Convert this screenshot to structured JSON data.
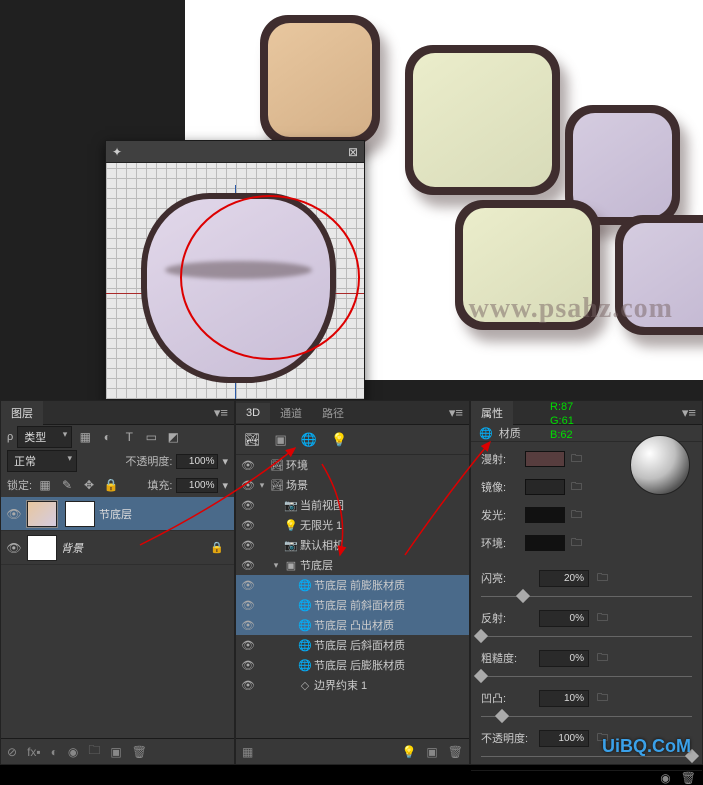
{
  "watermark": "www.psahz.com",
  "uibq": "UiBQ.CoM",
  "rgb": {
    "r": "R:87",
    "g": "G:61",
    "b": "B:62"
  },
  "layers_panel": {
    "tab": "图层",
    "kind_label": "类型",
    "blend_mode": "正常",
    "opacity_label": "不透明度:",
    "opacity_value": "100%",
    "lock_label": "锁定:",
    "fill_label": "填充:",
    "fill_value": "100%",
    "items": [
      {
        "name": "节底层",
        "active": true
      },
      {
        "name": "背景",
        "active": false
      }
    ]
  },
  "three_d_panel": {
    "tabs": [
      "3D",
      "通道",
      "路径"
    ],
    "tree": [
      {
        "depth": 0,
        "icon": "🏞",
        "name": "环境",
        "twisty": ""
      },
      {
        "depth": 0,
        "icon": "🏞",
        "name": "场景",
        "twisty": "▾"
      },
      {
        "depth": 1,
        "icon": "📷",
        "name": "当前视图",
        "twisty": ""
      },
      {
        "depth": 1,
        "icon": "💡",
        "name": "无限光 1",
        "twisty": ""
      },
      {
        "depth": 1,
        "icon": "📷",
        "name": "默认相机",
        "twisty": ""
      },
      {
        "depth": 1,
        "icon": "▣",
        "name": "节底层",
        "twisty": "▾"
      },
      {
        "depth": 2,
        "icon": "🌐",
        "name": "节底层 前膨胀材质",
        "sel": true
      },
      {
        "depth": 2,
        "icon": "🌐",
        "name": "节底层 前斜面材质",
        "sel": true
      },
      {
        "depth": 2,
        "icon": "🌐",
        "name": "节底层 凸出材质",
        "sel": true
      },
      {
        "depth": 2,
        "icon": "🌐",
        "name": "节底层 后斜面材质"
      },
      {
        "depth": 2,
        "icon": "🌐",
        "name": "节底层 后膨胀材质"
      },
      {
        "depth": 2,
        "icon": "◇",
        "name": "边界约束 1"
      }
    ]
  },
  "props_panel": {
    "tab": "属性",
    "title": "材质",
    "rows": [
      {
        "label": "漫射:",
        "color": "#573d3e"
      },
      {
        "label": "镜像:",
        "color": "#272727"
      },
      {
        "label": "发光:",
        "color": "#111111"
      },
      {
        "label": "环境:",
        "color": "#111111"
      }
    ],
    "sliders": [
      {
        "label": "闪亮:",
        "value": "20%",
        "pos": 20
      },
      {
        "label": "反射:",
        "value": "0%",
        "pos": 0
      },
      {
        "label": "粗糙度:",
        "value": "0%",
        "pos": 0
      },
      {
        "label": "凹凸:",
        "value": "10%",
        "pos": 10
      },
      {
        "label": "不透明度:",
        "value": "100%",
        "pos": 100
      }
    ]
  }
}
